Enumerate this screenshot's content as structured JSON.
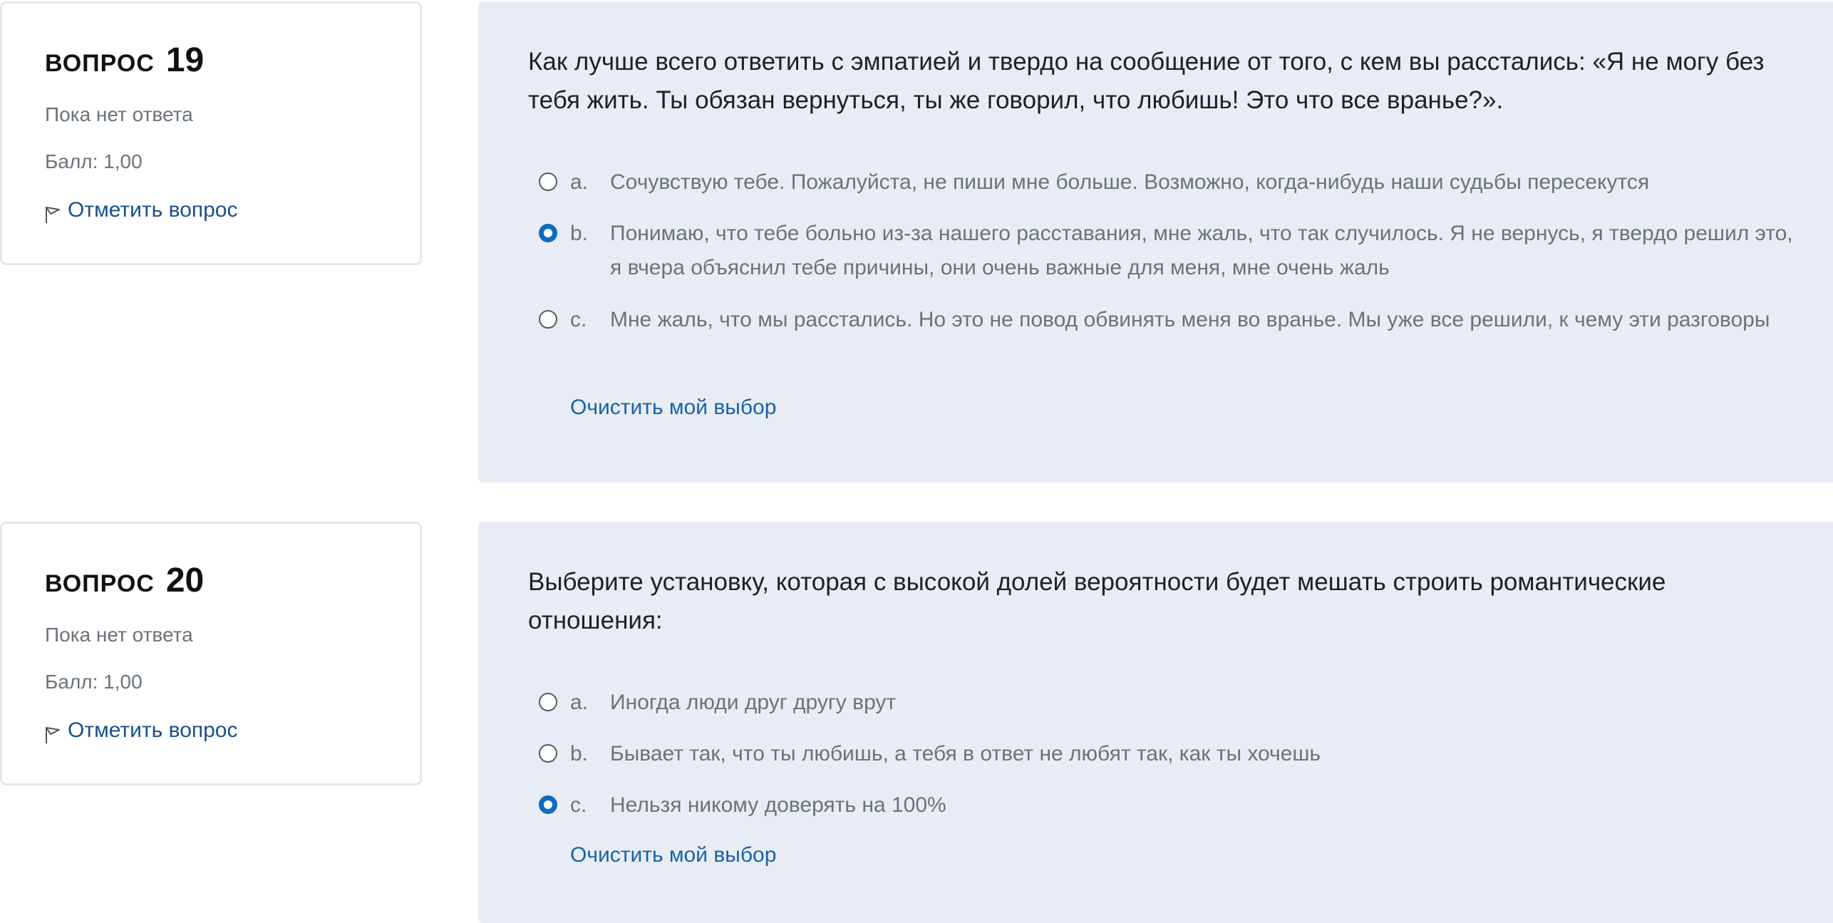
{
  "questions": [
    {
      "label": "ВОПРОС",
      "number": "19",
      "state": "Пока нет ответа",
      "grade": "Балл: 1,00",
      "flag_label": "Отметить вопрос",
      "flag_icon": "flag-icon",
      "text": "Как лучше всего ответить с эмпатией и твердо на сообщение от того, с кем вы расстались: «Я не могу без тебя жить. Ты обязан вернуться, ты же говорил, что любишь! Это что все вранье?».",
      "answers": [
        {
          "letter": "a.",
          "text": "Сочувствую тебе. Пожалуйста, не пиши мне больше. Возможно, когда-нибудь наши судьбы пересекутся",
          "selected": false
        },
        {
          "letter": "b.",
          "text": "Понимаю, что тебе больно из-за нашего расставания, мне жаль, что так случилось. Я не вернусь, я твердо решил это, я вчера объяснил тебе причины, они очень важные для меня, мне очень жаль",
          "selected": true
        },
        {
          "letter": "c.",
          "text": "Мне жаль, что мы расстались. Но это не повод обвинять меня во вранье. Мы уже все решили, к чему эти разговоры",
          "selected": false
        }
      ],
      "clear_label": "Очистить мой выбор"
    },
    {
      "label": "ВОПРОС",
      "number": "20",
      "state": "Пока нет ответа",
      "grade": "Балл: 1,00",
      "flag_label": "Отметить вопрос",
      "flag_icon": "flag-icon",
      "text": "Выберите установку, которая с высокой долей вероятности будет мешать строить романтические отношения:",
      "answers": [
        {
          "letter": "a.",
          "text": "Иногда люди друг другу врут",
          "selected": false
        },
        {
          "letter": "b.",
          "text": "Бывает так, что ты любишь, а тебя в ответ не любят так, как ты хочешь",
          "selected": false
        },
        {
          "letter": "c.",
          "text": "Нельзя никому доверять на 100%",
          "selected": true
        }
      ],
      "clear_label": "Очистить мой выбор"
    }
  ],
  "colors": {
    "accent": "#0f6cbf",
    "link": "#1a61a8",
    "content_bg": "#e8edf5",
    "muted_text": "#6a737b"
  }
}
